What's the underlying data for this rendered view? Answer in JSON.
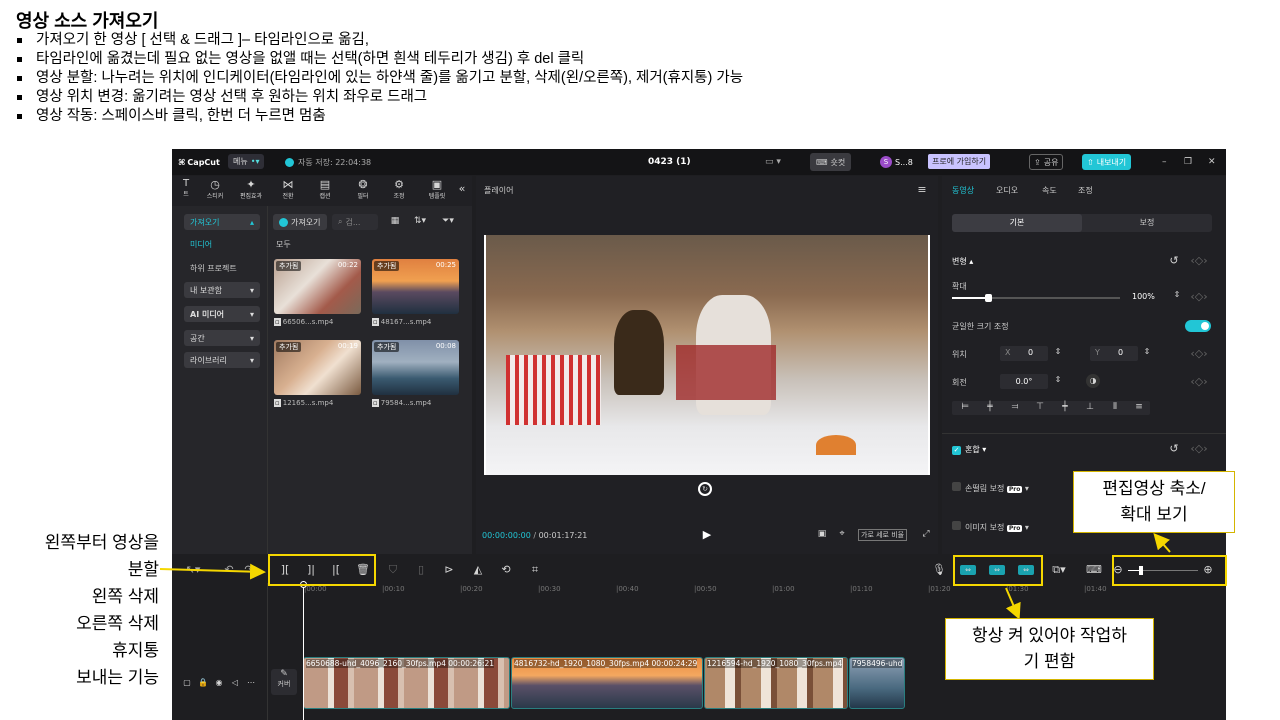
{
  "heading": "영상 소스 가져오기",
  "bullets": [
    "가져오기 한 영상 [ 선택 & 드래그 ]– 타임라인으로 옮김,",
    "타임라인에 옮겼는데 필요 없는 영상을 없앨 때는 선택(하면 흰색 테두리가 생김) 후 del 클릭",
    "영상 분할: 나누려는 위치에 인디케이터(타임라인에 있는 하얀색 줄)를 옮기고 분할, 삭제(왼/오른쪽), 제거(휴지통) 가능",
    "영상 위치 변경: 옮기려는 영상 선택 후 원하는 위치 좌우로 드래그",
    "영상 작동: 스페이스바 클릭, 한번 더 누르면 멈춤"
  ],
  "app": {
    "logo": "CapCut",
    "menu": "메뉴",
    "autosave": "자동 저장: 22:04:38",
    "project_title": "0423 (1)",
    "shortcut": "숏컷",
    "user": "S...8",
    "pro_join": "프로에 가입하기",
    "share": "공유",
    "export": "내보내기"
  },
  "media_tabs": [
    "미디어",
    "오디오",
    "텍스트",
    "스티커",
    "편집효과",
    "전환",
    "캡션",
    "필터",
    "조정",
    "템플릿"
  ],
  "media_tabs_visible": [
    "스티커",
    "편집효과",
    "전환",
    "캡션",
    "필터",
    "조정",
    "템플릿"
  ],
  "left_nav": {
    "import": "가져오기",
    "media": "미디어",
    "sub_project": "하위 프로젝트",
    "my_storage": "내 보관함",
    "ai_media": "AI 미디어",
    "space": "공간",
    "library": "라이브러리"
  },
  "media_panel": {
    "import_button": "가져오기",
    "search_placeholder": "검...",
    "all_label": "모두",
    "items": [
      {
        "tag": "추가됨",
        "duration": "00:22",
        "name": "66506...s.mp4"
      },
      {
        "tag": "추가됨",
        "duration": "00:25",
        "name": "48167...s.mp4"
      },
      {
        "tag": "추가됨",
        "duration": "00:19",
        "name": "12165...s.mp4"
      },
      {
        "tag": "추가됨",
        "duration": "00:08",
        "name": "79584...s.mp4"
      }
    ]
  },
  "player": {
    "title": "플레이어",
    "current_time": "00:00:00:00",
    "total_time": "00:01:17:21",
    "ratio": "가로 세로 비율"
  },
  "inspector": {
    "tabs": [
      "동영상",
      "오디오",
      "속도",
      "조정"
    ],
    "subtabs": [
      "기본",
      "보정"
    ],
    "transform": "변형",
    "scale_label": "확대",
    "scale_value": "100%",
    "uniform_scale": "균일한 크기 조정",
    "position_label": "위치",
    "pos_x_label": "X",
    "pos_x": "0",
    "pos_y_label": "Y",
    "pos_y": "0",
    "rotate_label": "회전",
    "rotate_value": "0.0°",
    "blend": "혼합",
    "retouch": "손떨림 보정",
    "image_correction": "이미지 보정",
    "pro": "Pro"
  },
  "timeline": {
    "ticks": [
      "|00:00",
      "|00:10",
      "|00:20",
      "|00:30",
      "|00:40",
      "|00:50",
      "|01:00",
      "|01:10",
      "|01:20",
      "|01:30",
      "|01:40"
    ],
    "cover": "커버",
    "clips": [
      {
        "label": "6650688-uhd_4096_2160_30fps.mp4  00:00:26:21"
      },
      {
        "label": "4816732-hd_1920_1080_30fps.mp4  00:00:24:29"
      },
      {
        "label": "1216594-hd_1920_1080_30fps.mp4"
      },
      {
        "label": "7958496-uhd"
      }
    ]
  },
  "annotations": {
    "left_lines": [
      "왼쪽부터 영상을",
      "분할",
      "왼쪽 삭제",
      "오른쪽 삭제",
      "휴지통",
      "보내는 기능"
    ],
    "zoom_callout_1": "편집영상 축소/",
    "zoom_callout_2": "확대 보기",
    "snap_callout_1": "항상 켜 있어야 작업하",
    "snap_callout_2": "기 편함"
  },
  "colors": {
    "accent": "#22c6d6",
    "annotation": "#f5d700",
    "pro_badge": "#c9c3ff"
  }
}
